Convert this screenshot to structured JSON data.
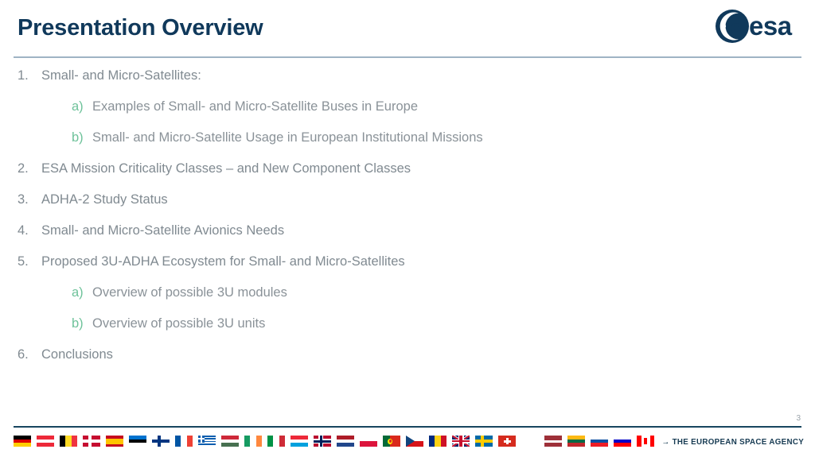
{
  "header": {
    "title": "Presentation Overview",
    "logo": {
      "name": "esa-logo",
      "wordmark": "esa",
      "color": "#10395b"
    },
    "divider_color": "#9fb3c4"
  },
  "outline": {
    "items": [
      {
        "level": 1,
        "marker": "1.",
        "text": "Small- and Micro-Satellites:"
      },
      {
        "level": 2,
        "marker": "a)",
        "text": "Examples of Small- and Micro-Satellite Buses in Europe"
      },
      {
        "level": 2,
        "marker": "b)",
        "text": "Small- and Micro-Satellite Usage in European Institutional Missions"
      },
      {
        "level": 1,
        "marker": "2.",
        "text": "ESA Mission Criticality Classes – and New Component Classes"
      },
      {
        "level": 1,
        "marker": "3.",
        "text": "ADHA-2 Study Status"
      },
      {
        "level": 1,
        "marker": "4.",
        "text": "Small- and Micro-Satellite Avionics Needs"
      },
      {
        "level": 1,
        "marker": "5.",
        "text": "Proposed 3U-ADHA Ecosystem for Small- and Micro-Satellites"
      },
      {
        "level": 2,
        "marker": "a)",
        "text": "Overview of possible 3U modules"
      },
      {
        "level": 2,
        "marker": "b)",
        "text": "Overview of possible 3U units"
      },
      {
        "level": 1,
        "marker": "6.",
        "text": "Conclusions"
      }
    ],
    "marker_color_level1": "#808a91",
    "marker_color_level2": "#6ec29a",
    "text_color": "#808a91"
  },
  "footer": {
    "slide_number": "3",
    "tagline": "→ THE EUROPEAN SPACE AGENCY",
    "divider_color": "#17455f",
    "member_state_flags": [
      "Germany",
      "Austria",
      "Belgium",
      "Denmark",
      "Spain",
      "Estonia",
      "Finland",
      "France",
      "Greece",
      "Hungary",
      "Ireland",
      "Italy",
      "Luxembourg",
      "Norway",
      "Netherlands",
      "Poland",
      "Portugal",
      "Czech Republic",
      "Romania",
      "United Kingdom",
      "Sweden",
      "Switzerland",
      "Latvia",
      "Lithuania",
      "Slovakia",
      "Slovenia",
      "Canada"
    ]
  }
}
